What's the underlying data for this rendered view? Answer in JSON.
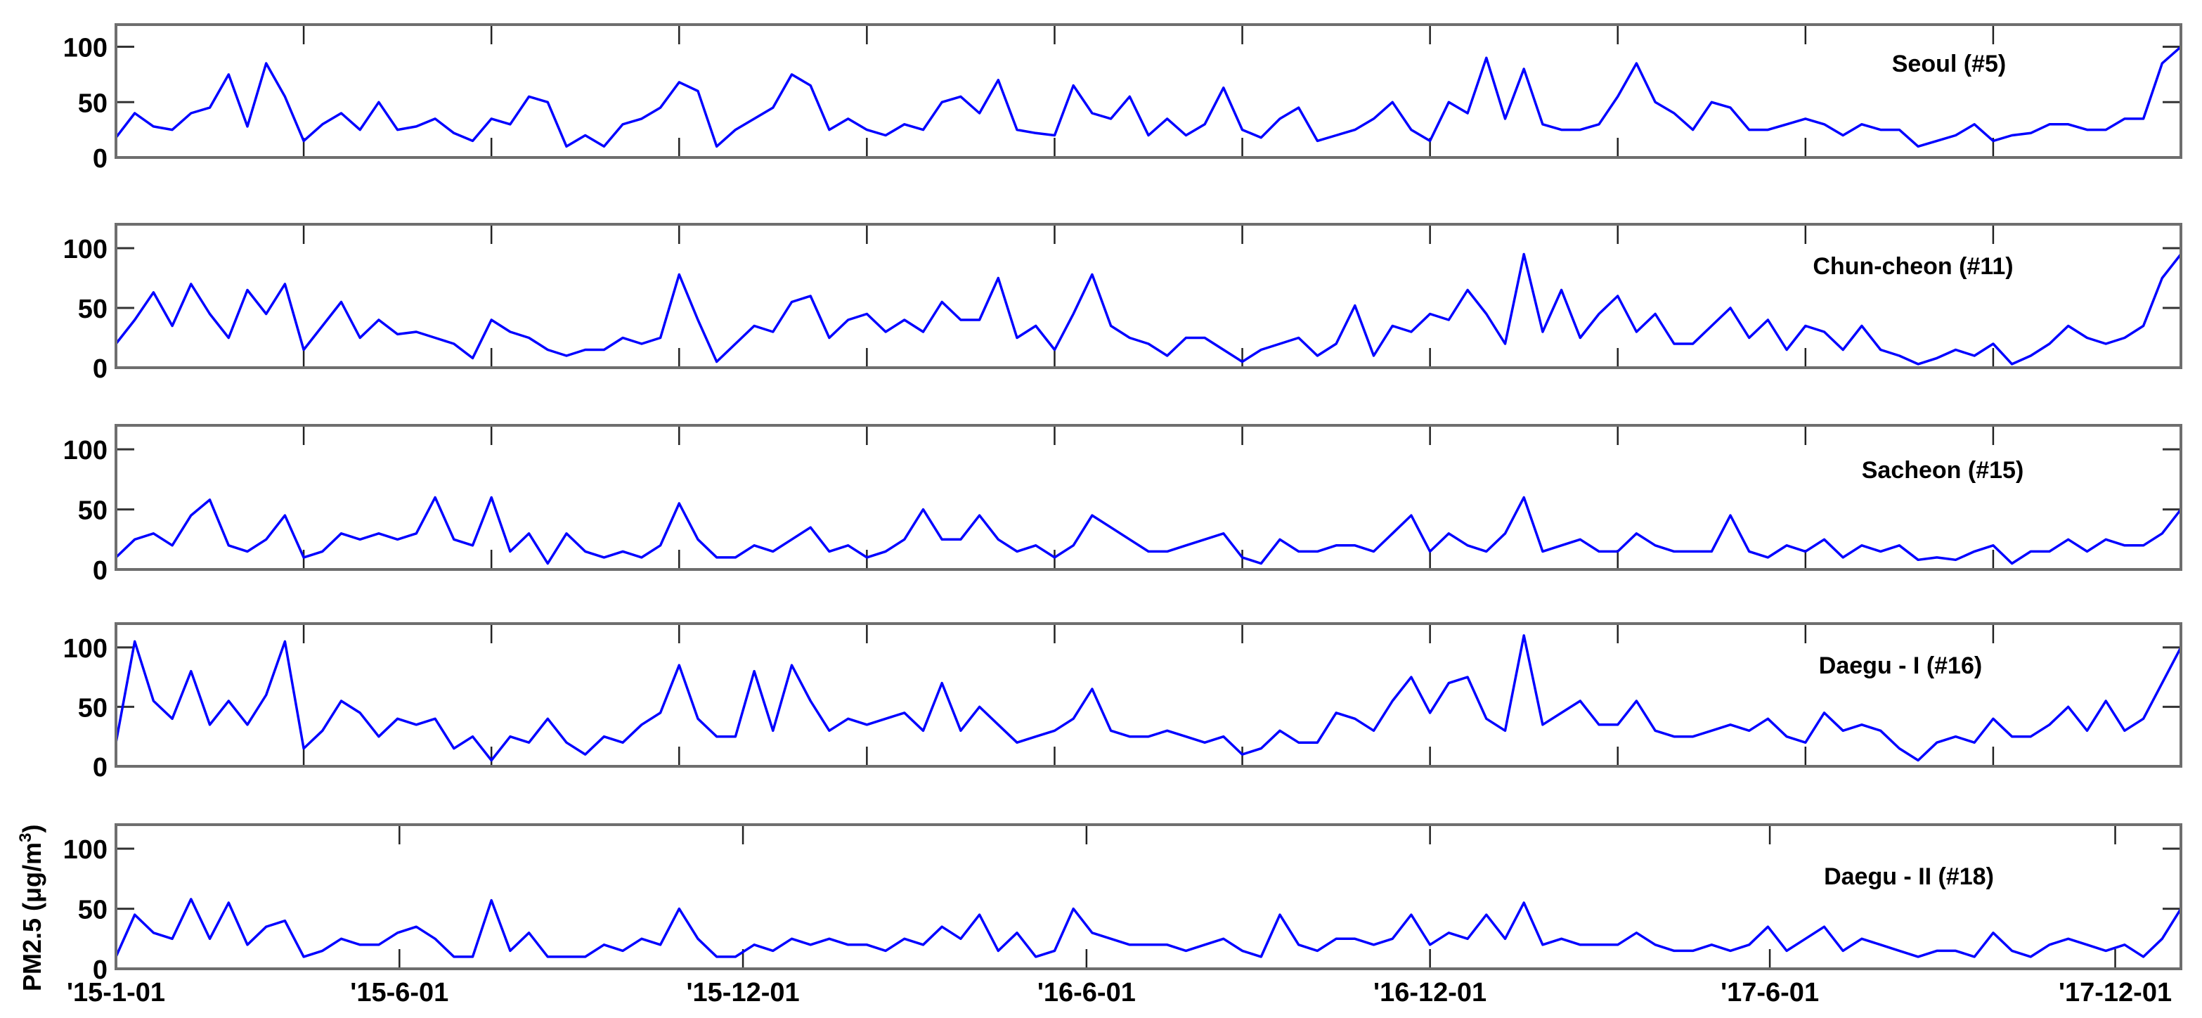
{
  "chart_data": {
    "type": "line",
    "ylabel": "PM2.5 (μg/m3)",
    "ylabel_main": "PM2.5 (μg/m",
    "ylabel_sup": "3",
    "ylabel_close": ")",
    "x_unit": "days since 2015-01-01",
    "x_start": 0,
    "x_step": 10,
    "xlim": [
      0,
      1100
    ],
    "ylim": [
      0,
      120
    ],
    "yticks": [
      0,
      50,
      100
    ],
    "ytick_labels": [
      "0",
      "50",
      "100"
    ],
    "minor_xticks_days": [
      100,
      200,
      300,
      400,
      500,
      600,
      700,
      800,
      900,
      1000
    ],
    "xticks": [
      {
        "day": 0,
        "label": "'15-1-01"
      },
      {
        "day": 151,
        "label": "'15-6-01"
      },
      {
        "day": 334,
        "label": "'15-12-01"
      },
      {
        "day": 517,
        "label": "'16-6-01"
      },
      {
        "day": 700,
        "label": "'16-12-01"
      },
      {
        "day": 881,
        "label": "'17-6-01"
      },
      {
        "day": 1065,
        "label": "'17-12-01"
      }
    ],
    "line_color": "#0000ff",
    "series": [
      {
        "name": "Seoul (#5)",
        "values": [
          18,
          40,
          28,
          25,
          40,
          45,
          75,
          28,
          85,
          55,
          15,
          30,
          40,
          25,
          50,
          25,
          28,
          35,
          22,
          15,
          35,
          30,
          55,
          50,
          10,
          20,
          10,
          30,
          35,
          45,
          68,
          60,
          10,
          25,
          35,
          45,
          75,
          65,
          25,
          35,
          25,
          20,
          30,
          25,
          50,
          55,
          40,
          70,
          25,
          22,
          20,
          65,
          40,
          35,
          55,
          20,
          35,
          20,
          30,
          63,
          25,
          18,
          35,
          45,
          15,
          20,
          25,
          35,
          50,
          25,
          15,
          50,
          40,
          90,
          35,
          80,
          30,
          25,
          25,
          30,
          55,
          85,
          50,
          40,
          25,
          50,
          45,
          25,
          25,
          30,
          35,
          30,
          20,
          30,
          25,
          25,
          10,
          15,
          20,
          30,
          15,
          20,
          22,
          30,
          30,
          25,
          25,
          35,
          35,
          85,
          100
        ]
      },
      {
        "name": "Chun-cheon (#11)",
        "values": [
          20,
          40,
          63,
          35,
          70,
          45,
          25,
          65,
          45,
          70,
          15,
          35,
          55,
          25,
          40,
          28,
          30,
          25,
          20,
          8,
          40,
          30,
          25,
          15,
          10,
          15,
          15,
          25,
          20,
          25,
          78,
          40,
          5,
          20,
          35,
          30,
          55,
          60,
          25,
          40,
          45,
          30,
          40,
          30,
          55,
          40,
          40,
          75,
          25,
          35,
          15,
          45,
          78,
          35,
          25,
          20,
          10,
          25,
          25,
          15,
          5,
          15,
          20,
          25,
          10,
          20,
          52,
          10,
          35,
          30,
          45,
          40,
          65,
          45,
          20,
          95,
          30,
          65,
          25,
          45,
          60,
          30,
          45,
          20,
          20,
          35,
          50,
          25,
          40,
          15,
          35,
          30,
          15,
          35,
          15,
          10,
          3,
          8,
          15,
          10,
          20,
          3,
          10,
          20,
          35,
          25,
          20,
          25,
          35,
          75,
          95
        ]
      },
      {
        "name": "Sacheon (#15)",
        "values": [
          10,
          25,
          30,
          20,
          45,
          58,
          20,
          15,
          25,
          45,
          10,
          15,
          30,
          25,
          30,
          25,
          30,
          60,
          25,
          20,
          60,
          15,
          30,
          5,
          30,
          15,
          10,
          15,
          10,
          20,
          55,
          25,
          10,
          10,
          20,
          15,
          25,
          35,
          15,
          20,
          10,
          15,
          25,
          50,
          25,
          25,
          45,
          25,
          15,
          20,
          10,
          20,
          45,
          35,
          25,
          15,
          15,
          20,
          25,
          30,
          10,
          5,
          25,
          15,
          15,
          20,
          20,
          15,
          30,
          45,
          15,
          30,
          20,
          15,
          30,
          60,
          15,
          20,
          25,
          15,
          15,
          30,
          20,
          15,
          15,
          15,
          45,
          15,
          10,
          20,
          15,
          25,
          10,
          20,
          15,
          20,
          8,
          10,
          8,
          15,
          20,
          5,
          15,
          15,
          25,
          15,
          25,
          20,
          20,
          30,
          50
        ]
      },
      {
        "name": "Daegu - I (#16)",
        "values": [
          20,
          105,
          55,
          40,
          80,
          35,
          55,
          35,
          60,
          105,
          15,
          30,
          55,
          45,
          25,
          40,
          35,
          40,
          15,
          25,
          5,
          25,
          20,
          40,
          20,
          10,
          25,
          20,
          35,
          45,
          85,
          40,
          25,
          25,
          80,
          30,
          85,
          55,
          30,
          40,
          35,
          40,
          45,
          30,
          70,
          30,
          50,
          35,
          20,
          25,
          30,
          40,
          65,
          30,
          25,
          25,
          30,
          25,
          20,
          25,
          10,
          15,
          30,
          20,
          20,
          45,
          40,
          30,
          55,
          75,
          45,
          70,
          75,
          40,
          30,
          110,
          35,
          45,
          55,
          35,
          35,
          55,
          30,
          25,
          25,
          30,
          35,
          30,
          40,
          25,
          20,
          45,
          30,
          35,
          30,
          15,
          5,
          20,
          25,
          20,
          40,
          25,
          25,
          35,
          50,
          30,
          55,
          30,
          40,
          70,
          100
        ]
      },
      {
        "name": "Daegu - II (#18)",
        "values": [
          10,
          45,
          30,
          25,
          58,
          25,
          55,
          20,
          35,
          40,
          10,
          15,
          25,
          20,
          20,
          30,
          35,
          25,
          10,
          10,
          57,
          15,
          30,
          10,
          10,
          10,
          20,
          15,
          25,
          20,
          50,
          25,
          10,
          10,
          20,
          15,
          25,
          20,
          25,
          20,
          20,
          15,
          25,
          20,
          35,
          25,
          45,
          15,
          30,
          10,
          15,
          50,
          30,
          25,
          20,
          20,
          20,
          15,
          20,
          25,
          15,
          10,
          45,
          20,
          15,
          25,
          25,
          20,
          25,
          45,
          20,
          30,
          25,
          45,
          25,
          55,
          20,
          25,
          20,
          20,
          20,
          30,
          20,
          15,
          15,
          20,
          15,
          20,
          35,
          15,
          25,
          35,
          15,
          25,
          20,
          15,
          10,
          15,
          15,
          10,
          30,
          15,
          10,
          20,
          25,
          20,
          15,
          20,
          10,
          25,
          50
        ]
      }
    ]
  }
}
